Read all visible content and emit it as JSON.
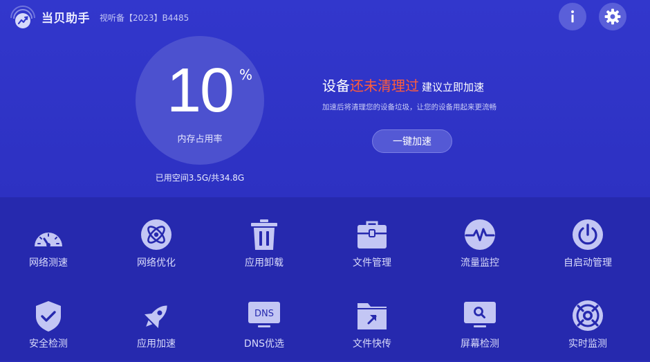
{
  "header": {
    "app_title": "当贝助手",
    "license": "视听备【2023】B4485",
    "info_glyph": "i",
    "icons": {
      "logo": "dangbei-logo-icon",
      "info": "info-icon",
      "settings": "gear-icon"
    }
  },
  "memory": {
    "usage_value": "10",
    "usage_unit": "%",
    "usage_label": "内存占用率",
    "storage_text": "已用空间3.5G/共34.8G"
  },
  "status": {
    "prefix": "设备",
    "highlight": "还未清理过",
    "suffix": "建议立即加速",
    "description": "加速后将清理您的设备垃圾，让您的设备用起来更流畅",
    "button_label": "一键加速"
  },
  "colors": {
    "background": "#2b2db8",
    "accent_warning": "#ff5d3b",
    "icon_fill": "#c3c6f4",
    "button": "#5459d5"
  },
  "tools": [
    {
      "label": "网络测速",
      "icon": "speedometer-icon"
    },
    {
      "label": "网络优化",
      "icon": "atom-icon"
    },
    {
      "label": "应用卸载",
      "icon": "trash-icon"
    },
    {
      "label": "文件管理",
      "icon": "briefcase-icon"
    },
    {
      "label": "流量监控",
      "icon": "pulse-icon"
    },
    {
      "label": "自启动管理",
      "icon": "power-icon"
    },
    {
      "label": "安全检测",
      "icon": "shield-check-icon"
    },
    {
      "label": "应用加速",
      "icon": "rocket-icon"
    },
    {
      "label": "DNS优选",
      "icon": "dns-monitor-icon",
      "icon_text": "DNS"
    },
    {
      "label": "文件快传",
      "icon": "folder-send-icon"
    },
    {
      "label": "屏幕检测",
      "icon": "monitor-search-icon"
    },
    {
      "label": "实时监测",
      "icon": "lifebuoy-icon"
    }
  ]
}
